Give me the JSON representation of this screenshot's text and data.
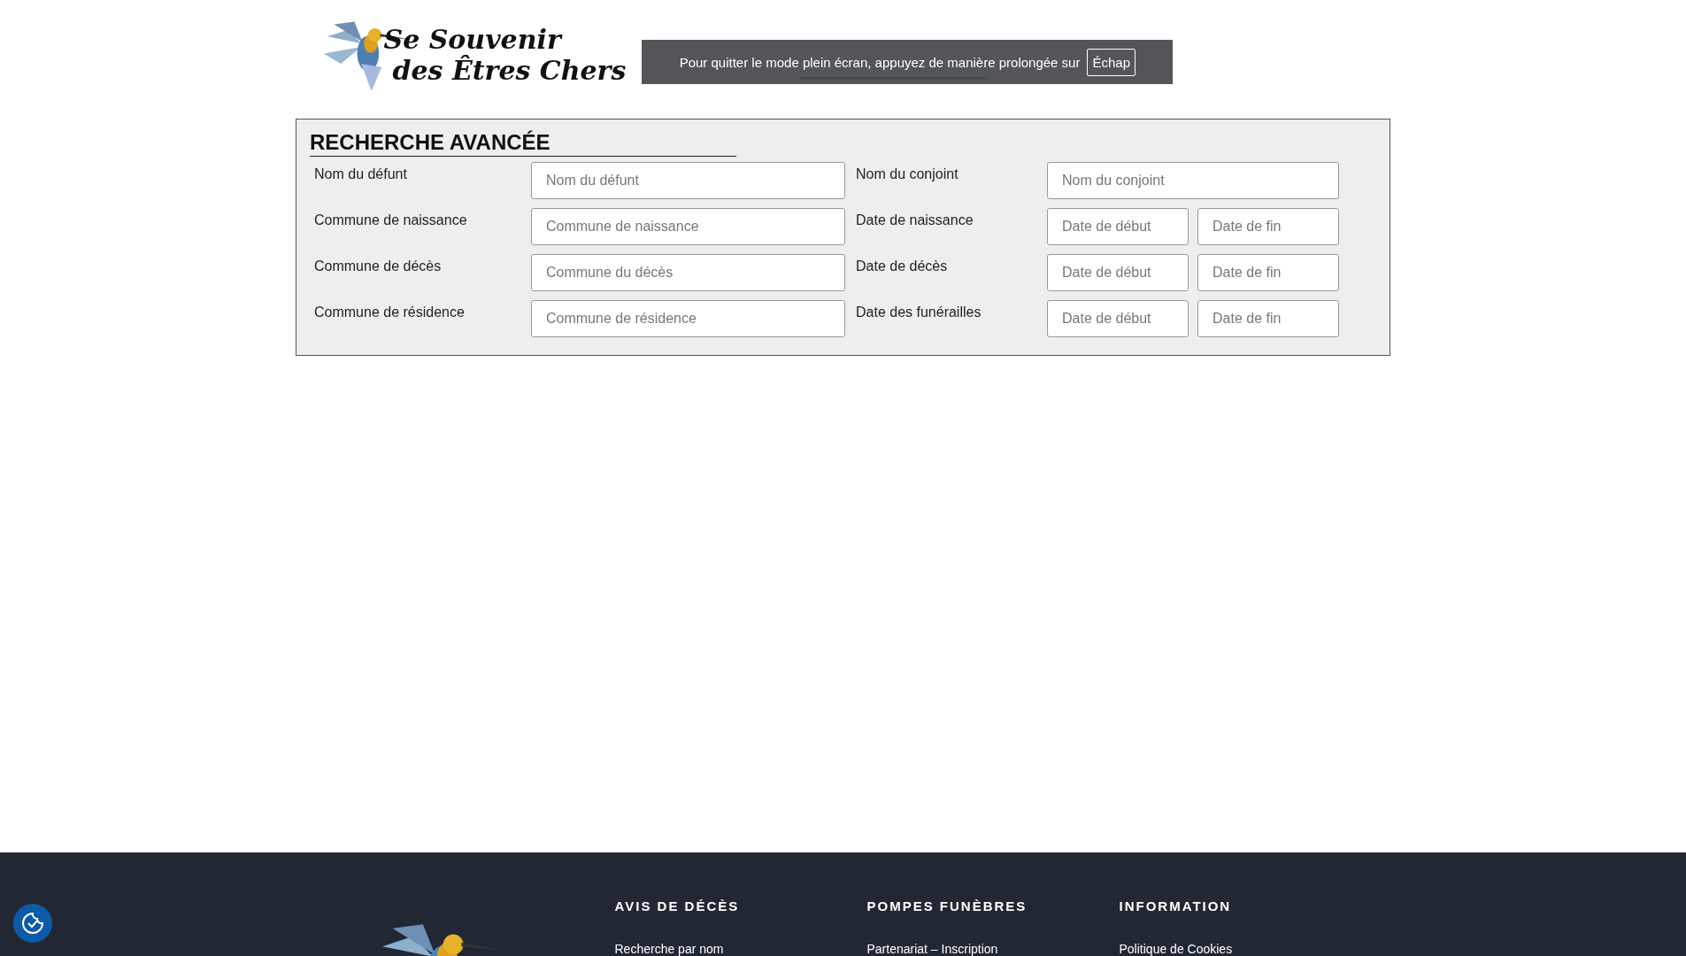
{
  "logo": {
    "lines": [
      "Se Souvenir",
      "des Êtres Chers"
    ]
  },
  "fullscreen_notice": {
    "message": "Pour quitter le mode plein écran, appuyez de manière prolongée sur",
    "key": "Échap"
  },
  "search": {
    "title": "RECHERCHE AVANCÉE",
    "rows": [
      {
        "left": {
          "label": "Nom du défunt",
          "placeholder": "Nom du défunt"
        },
        "right": {
          "label": "Nom du conjoint",
          "placeholders": [
            "Nom du conjoint"
          ]
        }
      },
      {
        "left": {
          "label": "Commune de naissance",
          "placeholder": "Commune de naissance"
        },
        "right": {
          "label": "Date de naissance",
          "placeholders": [
            "Date de début",
            "Date de fin"
          ]
        }
      },
      {
        "left": {
          "label": "Commune de décès",
          "placeholder": "Commune du décès"
        },
        "right": {
          "label": "Date de décès",
          "placeholders": [
            "Date de début",
            "Date de fin"
          ]
        }
      },
      {
        "left": {
          "label": "Commune de résidence",
          "placeholder": "Commune de résidence"
        },
        "right": {
          "label": "Date des funérailles",
          "placeholders": [
            "Date de début",
            "Date de fin"
          ]
        }
      }
    ]
  },
  "footer": {
    "columns": [
      {
        "heading": "AVIS DE DÉCÈS",
        "links": [
          "Recherche par nom"
        ]
      },
      {
        "heading": "POMPES FUNÈBRES",
        "links": [
          "Partenariat – Inscription"
        ]
      },
      {
        "heading": "INFORMATION",
        "links": [
          "Politique de Cookies"
        ]
      }
    ]
  }
}
